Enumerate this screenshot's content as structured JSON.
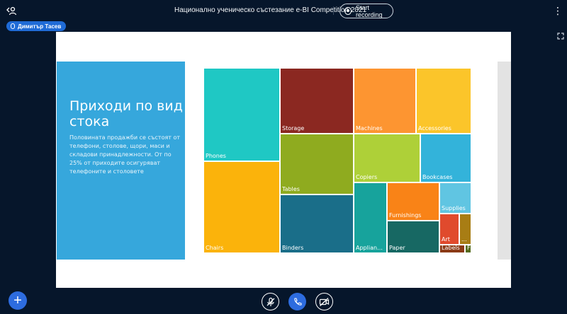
{
  "header": {
    "meeting_title": "Национално ученическо състезание e-BI Competition 2021",
    "record_label": "Start recording"
  },
  "speaker": {
    "name": "Димитър Тасев"
  },
  "slide": {
    "heading": "Приходи по вид стока",
    "description": "Половината продажби се състоят от телефони, столове, щори, маси и складови принадлежности. От по 25% от приходите осигуряват телефоните и столовете"
  },
  "treemap": {
    "tiles": [
      {
        "label": "Phones",
        "color": "#1fc8c4"
      },
      {
        "label": "Chairs",
        "color": "#fbb30b"
      },
      {
        "label": "Storage",
        "color": "#8b2821"
      },
      {
        "label": "Tables",
        "color": "#8fab1f"
      },
      {
        "label": "Binders",
        "color": "#1a6e89"
      },
      {
        "label": "Machines",
        "color": "#fd9531"
      },
      {
        "label": "Accessories",
        "color": "#fbc52a"
      },
      {
        "label": "Copiers",
        "color": "#aed038"
      },
      {
        "label": "Bookcases",
        "color": "#33b3da"
      },
      {
        "label": "Applianc...",
        "color": "#17a39c"
      },
      {
        "label": "Furnishings",
        "color": "#f98317"
      },
      {
        "label": "Paper",
        "color": "#176863"
      },
      {
        "label": "Supplies",
        "color": "#60c5e2"
      },
      {
        "label": "Art",
        "color": "#e04a2d"
      },
      {
        "label": "...",
        "color": "#a87d14"
      },
      {
        "label": "Labels",
        "color": "#8b3a16"
      },
      {
        "label": "F...",
        "color": "#556b1c"
      }
    ]
  },
  "controls": {
    "add": "+",
    "mic": "mic-muted-icon",
    "call": "phone-icon",
    "video": "camera-off-icon"
  }
}
